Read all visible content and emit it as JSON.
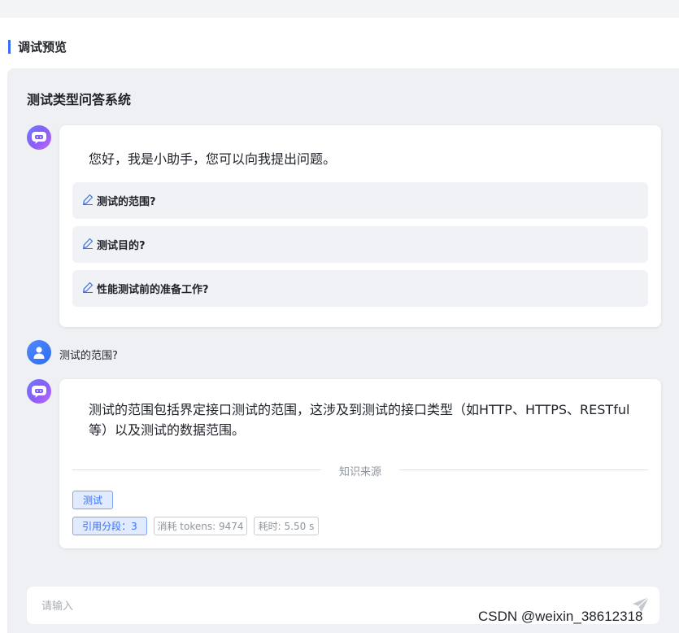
{
  "section": {
    "title": "调试预览"
  },
  "chat": {
    "title": "测试类型问答系统",
    "greeting": "您好，我是小助手，您可以向我提出问题。",
    "suggestions": [
      {
        "label": "测试的范围?"
      },
      {
        "label": "测试目的?"
      },
      {
        "label": "性能测试前的准备工作?"
      }
    ],
    "user_question": "测试的范围?",
    "answer": {
      "text": "测试的范围包括界定接口测试的范围，这涉及到测试的接口类型（如HTTP、HTTPS、RESTful等）以及测试的数据范围。",
      "divider_label": "知识来源",
      "source_tag": "测试",
      "cited_segments": "引用分段：3",
      "tokens": "消耗 tokens: 9474",
      "time": "耗时: 5.50 s"
    }
  },
  "input": {
    "placeholder": "请输入"
  },
  "watermark": "CSDN @weixin_38612318",
  "colors": {
    "accent": "#3370ff",
    "panel_bg": "#eef0f4",
    "bot_avatar": "#8b5cf6",
    "user_avatar": "#2f6bf0"
  }
}
